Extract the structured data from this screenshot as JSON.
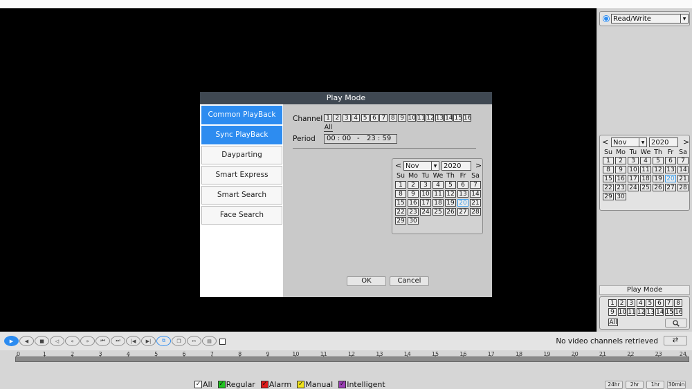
{
  "dialog": {
    "title": "Play Mode",
    "modes": [
      "Common PlayBack",
      "Sync PlayBack",
      "Dayparting",
      "Smart Express",
      "Smart Search",
      "Face Search"
    ],
    "channel_label": "Channel",
    "channels": [
      "1",
      "2",
      "3",
      "4",
      "5",
      "6",
      "7",
      "8",
      "9",
      "10",
      "11",
      "12",
      "13",
      "14",
      "15",
      "16"
    ],
    "all_label": "All",
    "period_label": "Period",
    "period_start": "00 : 00",
    "period_sep": "-",
    "period_end": "23 : 59",
    "month": "Nov",
    "year": "2020",
    "ok": "OK",
    "cancel": "Cancel"
  },
  "calendar": {
    "prev": "<",
    "next": ">",
    "weekdays": [
      "Su",
      "Mo",
      "Tu",
      "We",
      "Th",
      "Fr",
      "Sa"
    ],
    "days": [
      "1",
      "2",
      "3",
      "4",
      "5",
      "6",
      "7",
      "8",
      "9",
      "10",
      "11",
      "12",
      "13",
      "14",
      "15",
      "16",
      "17",
      "18",
      "19",
      "20",
      "21",
      "22",
      "23",
      "24",
      "25",
      "26",
      "27",
      "28",
      "29",
      "30"
    ],
    "highlighted_day": "20",
    "highlight_color": "#3a9be8"
  },
  "right_panel": {
    "mode_select": "Read/Write",
    "play_mode": "Play Mode",
    "channels": [
      "1",
      "2",
      "3",
      "4",
      "5",
      "6",
      "7",
      "8",
      "9",
      "10",
      "11",
      "12",
      "13",
      "14",
      "15",
      "16"
    ],
    "all_label": "All"
  },
  "status": {
    "message": "No video channels retrieved"
  },
  "timeline": {
    "ticks": [
      "0",
      "1",
      "2",
      "3",
      "4",
      "5",
      "6",
      "7",
      "8",
      "9",
      "10",
      "11",
      "12",
      "13",
      "14",
      "15",
      "16",
      "17",
      "18",
      "19",
      "20",
      "21",
      "22",
      "23",
      "24"
    ],
    "zoom": [
      "24hr",
      "2hr",
      "1hr",
      "30min"
    ]
  },
  "legend": [
    {
      "label": "All",
      "color": "#ffffff"
    },
    {
      "label": "Regular",
      "color": "#22c322"
    },
    {
      "label": "Alarm",
      "color": "#e01b1b"
    },
    {
      "label": "Manual",
      "color": "#f0e21c"
    },
    {
      "label": "Intelligent",
      "color": "#9b3fb5"
    }
  ],
  "colors": {
    "accent": "#2d8cf0",
    "title_bar": "#3f4852"
  },
  "playback_icons": [
    "play-icon",
    "rewind-icon",
    "stop-icon",
    "reverse-play-icon",
    "slow-icon",
    "fast-forward-icon",
    "prev-file-icon",
    "next-file-icon",
    "prev-frame-icon",
    "next-frame-icon",
    "fullscreen-icon",
    "snapshot-icon",
    "clip-icon",
    "save-icon"
  ]
}
